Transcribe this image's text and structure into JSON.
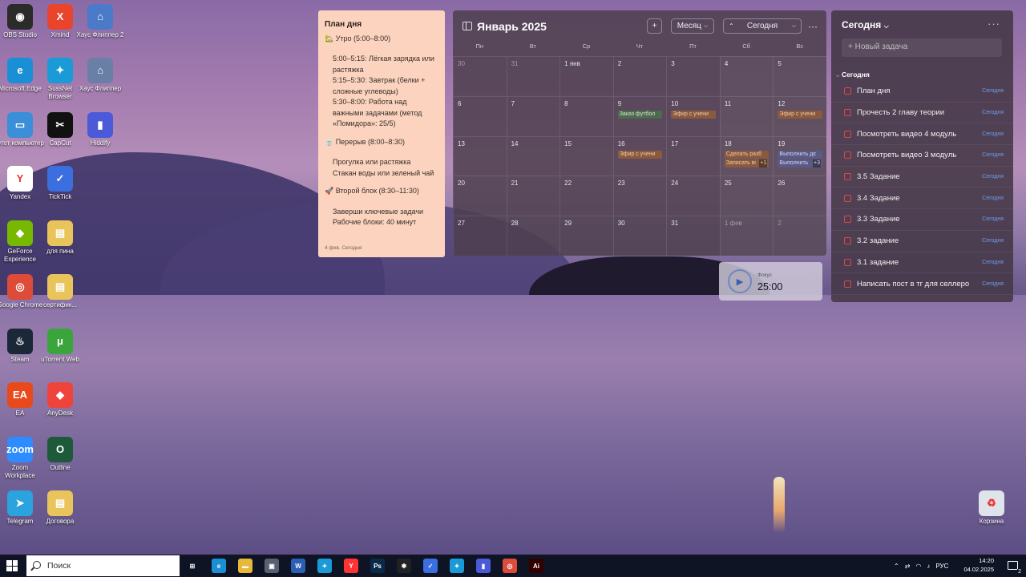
{
  "desktop_icons": [
    {
      "label": "OBS Studio",
      "glyph": "◉",
      "color": "#2b2b2b"
    },
    {
      "label": "Xmind",
      "glyph": "X",
      "color": "#e8452c"
    },
    {
      "label": "Хаус Флиппер 2",
      "glyph": "⌂",
      "color": "#4a7ac8"
    },
    {
      "label": "Microsoft Edge",
      "glyph": "e",
      "color": "#1b8fd6"
    },
    {
      "label": "SussNet Browser",
      "glyph": "✦",
      "color": "#1a9bd8"
    },
    {
      "label": "Хаус Флиппер",
      "glyph": "⌂",
      "color": "#6a7fa6"
    },
    {
      "label": "Этот компьютер",
      "glyph": "▭",
      "color": "#3a8fd8"
    },
    {
      "label": "CapCut",
      "glyph": "✂",
      "color": "#111111"
    },
    {
      "label": "Hiddify",
      "glyph": "▮",
      "color": "#4a5ad8"
    },
    {
      "label": "Yandex",
      "glyph": "Y",
      "color": "#ffffff"
    },
    {
      "label": "TickTick",
      "glyph": "✓",
      "color": "#3b6fe0"
    },
    {
      "label": "GeForce Experience",
      "glyph": "◆",
      "color": "#76b900"
    },
    {
      "label": "для пина",
      "glyph": "▤",
      "color": "#e8c45a"
    },
    {
      "label": "Google Chrome",
      "glyph": "◎",
      "color": "#dd4b39"
    },
    {
      "label": "сертифик...",
      "glyph": "▤",
      "color": "#e8c45a"
    },
    {
      "label": "Steam",
      "glyph": "♨",
      "color": "#1b2838"
    },
    {
      "label": "uTorrent Web",
      "glyph": "μ",
      "color": "#3aa53a"
    },
    {
      "label": "EA",
      "glyph": "EA",
      "color": "#e84a1c"
    },
    {
      "label": "AnyDesk",
      "glyph": "◆",
      "color": "#ef443b"
    },
    {
      "label": "Zoom Workplace",
      "glyph": "zoom",
      "color": "#2d8cff"
    },
    {
      "label": "Outline",
      "glyph": "O",
      "color": "#1e5a3a"
    },
    {
      "label": "Telegram",
      "glyph": "➤",
      "color": "#2aa3de"
    },
    {
      "label": "Договора",
      "glyph": "▤",
      "color": "#e8c45a"
    },
    {
      "label": "Корзина",
      "glyph": "♻",
      "color": "#dfe4ea"
    }
  ],
  "note": {
    "title": "План дня",
    "blocks": [
      {
        "head": "🏡 Утро (5:00–8:00)",
        "items": [
          "5:00–5:15: Лёгкая зарядка или растяжка",
          "5:15–5:30: Завтрак (белки + сложные углеводы)",
          "5:30–8:00: Работа над важными задачами (метод «Помидора»: 25/5)"
        ]
      },
      {
        "head": "🍵 Перерыв (8:00–8:30)",
        "items": [
          "Прогулка или растяжка",
          "Стакан воды или зеленый чай"
        ]
      },
      {
        "head": "🚀 Второй блок (8:30–11:30)",
        "items": [
          "Заверши ключевые задачи",
          "Рабочие блоки: 40 минут"
        ]
      }
    ],
    "footer": "4 фев. Сегодня"
  },
  "calendar": {
    "title": "Январь 2025",
    "add_label": "+",
    "view_label": "Месяц",
    "today_label": "Сегодня",
    "more_label": "···",
    "dows": [
      "Пн",
      "Вт",
      "Ср",
      "Чт",
      "Пт",
      "Сб",
      "Вс"
    ],
    "cells": [
      {
        "day": "30",
        "dim": true,
        "events": []
      },
      {
        "day": "31",
        "dim": true,
        "events": []
      },
      {
        "day": "1 янв",
        "events": []
      },
      {
        "day": "2",
        "events": []
      },
      {
        "day": "3",
        "events": []
      },
      {
        "day": "4",
        "events": []
      },
      {
        "day": "5",
        "events": []
      },
      {
        "day": "6",
        "events": []
      },
      {
        "day": "7",
        "events": []
      },
      {
        "day": "8",
        "events": []
      },
      {
        "day": "9",
        "events": [
          {
            "t": "Заказ футбол",
            "c": "g"
          }
        ]
      },
      {
        "day": "10",
        "events": [
          {
            "t": "Эфир с учени",
            "c": "o"
          }
        ]
      },
      {
        "day": "11",
        "events": []
      },
      {
        "day": "12",
        "events": [
          {
            "t": "Эфир с учени",
            "c": "o"
          }
        ]
      },
      {
        "day": "13",
        "events": []
      },
      {
        "day": "14",
        "events": []
      },
      {
        "day": "15",
        "events": []
      },
      {
        "day": "16",
        "events": [
          {
            "t": "Эфир с учени",
            "c": "o"
          }
        ]
      },
      {
        "day": "17",
        "events": []
      },
      {
        "day": "18",
        "events": [
          {
            "t": "Сделать разб",
            "c": "o"
          },
          {
            "t": "Записать ві",
            "c": "o",
            "more": "+1"
          }
        ]
      },
      {
        "day": "19",
        "events": [
          {
            "t": "Выполнить дє",
            "c": "b"
          },
          {
            "t": "Выполнить",
            "c": "b",
            "more": "+3"
          }
        ]
      },
      {
        "day": "20",
        "events": []
      },
      {
        "day": "21",
        "events": []
      },
      {
        "day": "22",
        "events": []
      },
      {
        "day": "23",
        "events": []
      },
      {
        "day": "24",
        "events": []
      },
      {
        "day": "25",
        "events": []
      },
      {
        "day": "26",
        "events": []
      },
      {
        "day": "27",
        "events": []
      },
      {
        "day": "28",
        "events": []
      },
      {
        "day": "29",
        "events": []
      },
      {
        "day": "30",
        "events": []
      },
      {
        "day": "31",
        "events": []
      },
      {
        "day": "1 фев",
        "dim": true,
        "events": []
      },
      {
        "day": "2",
        "dim": true,
        "events": []
      }
    ]
  },
  "tasks": {
    "header": "Сегодня",
    "add_placeholder": "+ Новый задача",
    "section": "Сегодня",
    "items": [
      {
        "title": "План дня",
        "date": "Сегодня"
      },
      {
        "title": "Прочесть 2 главу теории",
        "date": "Сегодня"
      },
      {
        "title": "Посмотреть видео 4 модуль",
        "date": "Сегодня"
      },
      {
        "title": "Посмотреть видео 3 модуль",
        "date": "Сегодня"
      },
      {
        "title": "3.5 Задание",
        "date": "Сегодня"
      },
      {
        "title": "3.4 Задание",
        "date": "Сегодня"
      },
      {
        "title": "3.3 Задание",
        "date": "Сегодня"
      },
      {
        "title": "3.2 задание",
        "date": "Сегодня"
      },
      {
        "title": "3.1 задание",
        "date": "Сегодня"
      },
      {
        "title": "Написать пост в тг для селлеро",
        "date": "Сегодня"
      }
    ]
  },
  "focus": {
    "label": "Фокус",
    "time": "25:00"
  },
  "taskbar": {
    "search_placeholder": "Поиск",
    "apps": [
      {
        "name": "task-view",
        "glyph": "⊞",
        "color": "transparent"
      },
      {
        "name": "edge",
        "glyph": "e",
        "color": "#1b8fd6"
      },
      {
        "name": "explorer",
        "glyph": "▬",
        "color": "#e8b83a"
      },
      {
        "name": "store",
        "glyph": "▣",
        "color": "#5a6070"
      },
      {
        "name": "word",
        "glyph": "W",
        "color": "#2b5fb4"
      },
      {
        "name": "sussnet",
        "glyph": "✦",
        "color": "#1a9bd8"
      },
      {
        "name": "yandex",
        "glyph": "Y",
        "color": "#ff3333"
      },
      {
        "name": "photoshop",
        "glyph": "Ps",
        "color": "#0a2a4a"
      },
      {
        "name": "figma",
        "glyph": "✱",
        "color": "#222222"
      },
      {
        "name": "ticktick",
        "glyph": "✓",
        "color": "#3b6fe0"
      },
      {
        "name": "sussnet2",
        "glyph": "✦",
        "color": "#1a9bd8"
      },
      {
        "name": "hiddify",
        "glyph": "▮",
        "color": "#4a5ad8"
      },
      {
        "name": "chrome",
        "glyph": "◎",
        "color": "#dd4b39"
      },
      {
        "name": "illustrator",
        "glyph": "Ai",
        "color": "#330000"
      }
    ],
    "lang": "РУС",
    "time": "14:20",
    "date": "04.02.2025",
    "notifications": "2"
  }
}
